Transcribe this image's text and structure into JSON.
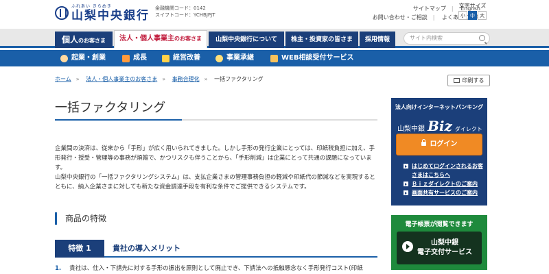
{
  "header": {
    "logo_tagline": "ふれあい きらめき",
    "logo_name": "山梨中央銀行",
    "bank_code": "金融機関コード：0142",
    "swift_code": "スイフトコード：YCHBJPJT",
    "links_row1": [
      "サイトマップ",
      "English"
    ],
    "links_row2": [
      "お問い合わせ・ご相談",
      "よくあるご質問"
    ],
    "font_size_label": "文字サイズ",
    "font_sizes": [
      "小",
      "中",
      "大"
    ],
    "font_size_selected": "中"
  },
  "mainnav": {
    "tabs": [
      {
        "main": "個人",
        "suffix": "のお客さま"
      },
      {
        "main": "法人・個人事業主",
        "suffix": "のお客さま"
      },
      {
        "main": "山梨中央銀行について",
        "suffix": ""
      },
      {
        "main": "株主・投資家の皆さま",
        "suffix": ""
      },
      {
        "main": "採用情報",
        "suffix": ""
      }
    ],
    "search_placeholder": "サイト内検索"
  },
  "subnav": {
    "items": [
      "起業・創業",
      "成長",
      "経営改善",
      "事業承継",
      "WEB相談受付サービス"
    ]
  },
  "breadcrumb": {
    "items": [
      "ホーム",
      "法人・個人事業主のお客さま",
      "事務合理化",
      "一括ファクタリング"
    ]
  },
  "print_label": "印刷する",
  "page_title": "一括ファクタリング",
  "intro": {
    "p1": "企業間の決済は、従来から「手形」が広く用いられてきました。しかし手形の発行企業にとっては、印紙税負担に加え、手形発行・授受・管理等の事務が煩雑で、かつリスクも伴うことから、「手形削減」は企業にとって共通の課題になっています。",
    "p2": "山梨中央銀行の「一括ファクタリングシステム」は、支払企業さまの管理事務負担の軽減や印紙代の節減などを実現するとともに、納入企業さまに対しても新たな資金調達手段を有利な条件でご提供できるシステムです。"
  },
  "section_title": "商品の特徴",
  "feature": {
    "badge": "特徴 1",
    "title": "貴社の導入メリット"
  },
  "list_item": {
    "num": "1.",
    "text": "貴社は、仕入・下請先に対する手形の振出を原則として廃止でき、下請法への抵触懸念なく手形発行コスト(印紙"
  },
  "biz": {
    "top": "法人向けインターネットバンキング",
    "bank": "山梨中銀",
    "biz": "Biz",
    "direct": "ダイレクト",
    "login": "ログイン",
    "links": [
      "はじめてログインされるお客さまはこちらへ",
      "Ｂｉｚダイレクトのご案内",
      "画面共有サービスのご案内"
    ]
  },
  "den": {
    "top": "電子帳票が閲覧できます",
    "line1": "山梨中銀",
    "line2": "電子交付サービス"
  },
  "colors": {
    "navy": "#1b3f7a",
    "blue": "#1a5fa8",
    "orange": "#f08a24",
    "green": "#1e8a3c",
    "red": "#c0193a"
  }
}
